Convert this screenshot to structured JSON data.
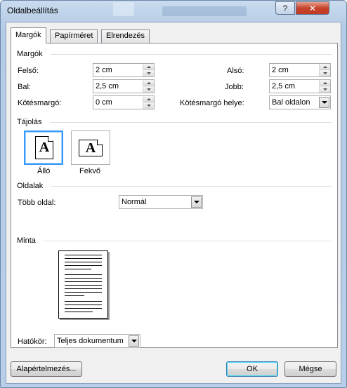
{
  "window": {
    "title": "Oldalbeállítás",
    "help_label": "?",
    "close_label": "✕"
  },
  "tabs": [
    {
      "label": "Margók",
      "active": true
    },
    {
      "label": "Papírméret",
      "active": false
    },
    {
      "label": "Elrendezés",
      "active": false
    }
  ],
  "margins": {
    "section_title": "Margók",
    "top": {
      "label": "Felső:",
      "value": "2 cm"
    },
    "bottom": {
      "label": "Alsó:",
      "value": "2 cm"
    },
    "left": {
      "label": "Bal:",
      "value": "2,5 cm"
    },
    "right": {
      "label": "Jobb:",
      "value": "2,5 cm"
    },
    "gutter": {
      "label": "Kötésmargó:",
      "value": "0 cm"
    },
    "gutter_position": {
      "label": "Kötésmargó helye:",
      "value": "Bal oldalon"
    }
  },
  "orientation": {
    "section_title": "Tájolás",
    "portrait": {
      "label": "Álló",
      "glyph": "A",
      "selected": true
    },
    "landscape": {
      "label": "Fekvő",
      "glyph": "A",
      "selected": false
    }
  },
  "pages": {
    "section_title": "Oldalak",
    "multiple_label": "Több oldal:",
    "multiple_value": "Normál"
  },
  "preview": {
    "section_title": "Minta",
    "apply_to_label": "Hatókör:",
    "apply_to_value": "Teljes dokumentum"
  },
  "buttons": {
    "default": "Alapértelmezés...",
    "ok": "OK",
    "cancel": "Mégse"
  },
  "colors": {
    "accent": "#3399ff",
    "titlebar": "#b9cee8",
    "close": "#c5432b"
  }
}
